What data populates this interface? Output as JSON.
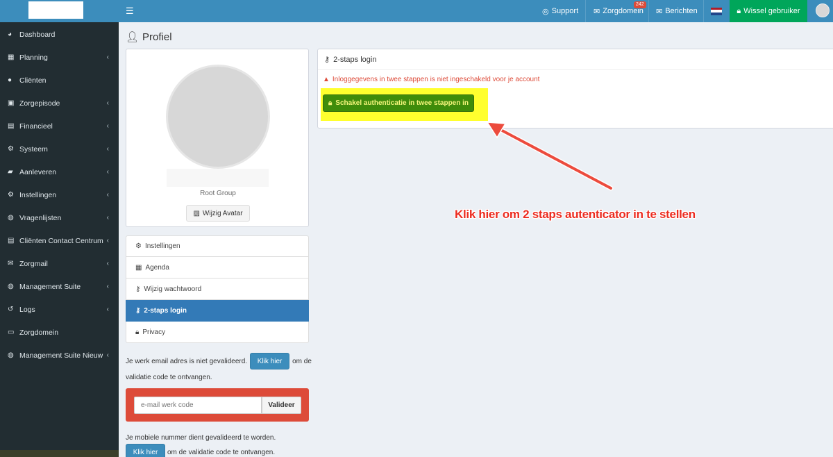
{
  "topbar": {
    "support_label": "Support",
    "zorgdomein_label": "Zorgdomein",
    "zorgdomein_badge": "242",
    "berichten_label": "Berichten",
    "switch_user_label": "Wissel gebruiker",
    "brand_color": "#3c8dbc"
  },
  "sidebar": {
    "items": [
      {
        "label": "Dashboard",
        "icon": "dashboard-icon",
        "has_children": false
      },
      {
        "label": "Planning",
        "icon": "calendar-icon",
        "has_children": true
      },
      {
        "label": "Cliënten",
        "icon": "user-icon",
        "has_children": false
      },
      {
        "label": "Zorgepisode",
        "icon": "medkit-icon",
        "has_children": true
      },
      {
        "label": "Financieel",
        "icon": "book-icon",
        "has_children": true
      },
      {
        "label": "Systeem",
        "icon": "gears-icon",
        "has_children": true
      },
      {
        "label": "Aanleveren",
        "icon": "truck-icon",
        "has_children": true
      },
      {
        "label": "Instellingen",
        "icon": "gear-icon",
        "has_children": true
      },
      {
        "label": "Vragenlijsten",
        "icon": "globe-icon",
        "has_children": true
      },
      {
        "label": "Cliënten Contact Centrum",
        "icon": "book-icon",
        "has_children": true
      },
      {
        "label": "Zorgmail",
        "icon": "envelope-icon",
        "has_children": true
      },
      {
        "label": "Management Suite",
        "icon": "globe-icon",
        "has_children": true
      },
      {
        "label": "Logs",
        "icon": "history-icon",
        "has_children": true
      },
      {
        "label": "Zorgdomein",
        "icon": "inbox-icon",
        "has_children": false
      },
      {
        "label": "Management Suite Nieuw",
        "icon": "globe-icon",
        "has_children": true
      }
    ]
  },
  "page": {
    "title": "Profiel"
  },
  "profile": {
    "role": "Root Group",
    "change_avatar_label": "Wijzig Avatar"
  },
  "menu": {
    "items": [
      {
        "label": "Instellingen",
        "icon": "gears-icon",
        "active": false
      },
      {
        "label": "Agenda",
        "icon": "calendar-check-icon",
        "active": false
      },
      {
        "label": "Wijzig wachtwoord",
        "icon": "key-icon",
        "active": false
      },
      {
        "label": "2-staps login",
        "icon": "key-icon",
        "active": true
      },
      {
        "label": "Privacy",
        "icon": "lock-icon",
        "active": false
      }
    ]
  },
  "email_validation": {
    "text_before": "Je werk email adres is niet gevalideerd.",
    "button_label": "Klik hier",
    "text_after": "om de",
    "text_line2": "validatie code te ontvangen.",
    "input_placeholder": "e-mail werk code",
    "validate_label": "Valideer"
  },
  "phone_validation": {
    "text_line1": "Je mobiele nummer dient gevalideerd te worden.",
    "button_label": "Klik hier",
    "text_after": "om de validatie code te ontvangen."
  },
  "twostep": {
    "header": "2-staps login",
    "alert": "Inloggegevens in twee stappen is niet ingeschakeld voor je account",
    "enable_button": "Schakel authenticatie in twee stappen in"
  },
  "annotation": {
    "callout": "Klik hier om 2 staps autenticator in te stellen",
    "color": "#ec2b1f"
  }
}
